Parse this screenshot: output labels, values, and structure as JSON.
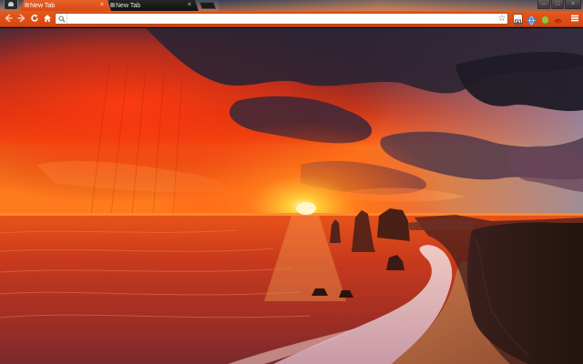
{
  "window": {
    "tabs": [
      {
        "title": "New Tab",
        "active": true,
        "close_glyph": "×"
      },
      {
        "title": "New Tab",
        "active": false,
        "close_glyph": "×"
      }
    ],
    "controls": {
      "minimize": "–",
      "maximize": "□",
      "close": "×"
    }
  },
  "toolbar": {
    "back": "back-arrow-icon",
    "forward": "forward-arrow-icon",
    "reload": "reload-icon",
    "home": "home-icon",
    "omnibox": {
      "value": "",
      "placeholder": "",
      "icon": "search-icon",
      "bookmark": "☆"
    },
    "extensions": [
      "page-action-icon",
      "globe-extension-icon",
      "android-extension-icon",
      "red-extension-icon"
    ],
    "menu": "menu-icon"
  },
  "theme": {
    "accent": "#d94a12",
    "toolbar_top": "#e35a1e",
    "inactive_tab": "#1a1a1a",
    "sky_sunset": "#ff3a0c",
    "sky_clouds": "#2d2b45",
    "sea": "#c4301a"
  },
  "background": {
    "subject": "coastal-sunset-sea-stacks"
  }
}
